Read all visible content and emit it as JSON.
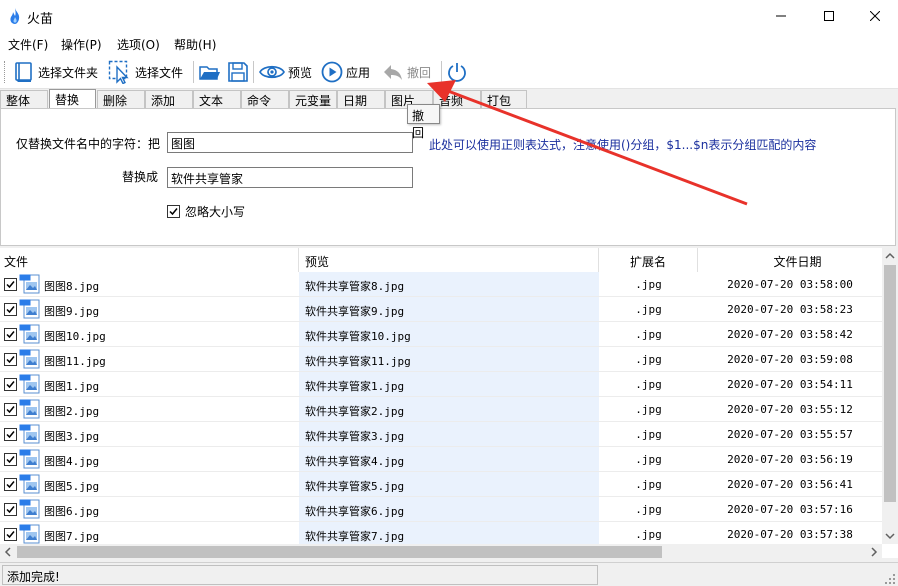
{
  "window": {
    "title": "火苗",
    "minimize_icon": "minimize-icon",
    "maximize_icon": "maximize-icon",
    "close_icon": "close-icon"
  },
  "menu": {
    "items": [
      "文件(F)",
      "操作(P)",
      "选项(O)",
      "帮助(H)"
    ]
  },
  "toolbar": {
    "select_folder": "选择文件夹",
    "select_file": "选择文件",
    "preview": "预览",
    "apply": "应用",
    "undo": "撤回"
  },
  "tabs": [
    "整体",
    "替换",
    "删除",
    "添加",
    "文本",
    "命令",
    "元变量",
    "日期",
    "图片",
    "音频",
    "打包"
  ],
  "active_tab": "替换",
  "tooltip": "撤回",
  "replace_panel": {
    "find_label": "仅替换文件名中的字符：把",
    "find_value": "图图",
    "hint": "此处可以使用正则表达式，注意使用()分组，$1...$n表示分组匹配的内容",
    "replace_label": "替换成",
    "replace_value": "软件共享管家",
    "ignore_case_label": "忽略大小写",
    "ignore_case_checked": true
  },
  "file_table": {
    "headers": [
      "文件",
      "预览",
      "扩展名",
      "文件日期"
    ],
    "rows": [
      {
        "file": "图图8.jpg",
        "preview": "软件共享管家8.jpg",
        "ext": ".jpg",
        "date": "2020-07-20 03:58:00"
      },
      {
        "file": "图图9.jpg",
        "preview": "软件共享管家9.jpg",
        "ext": ".jpg",
        "date": "2020-07-20 03:58:23"
      },
      {
        "file": "图图10.jpg",
        "preview": "软件共享管家10.jpg",
        "ext": ".jpg",
        "date": "2020-07-20 03:58:42"
      },
      {
        "file": "图图11.jpg",
        "preview": "软件共享管家11.jpg",
        "ext": ".jpg",
        "date": "2020-07-20 03:59:08"
      },
      {
        "file": "图图1.jpg",
        "preview": "软件共享管家1.jpg",
        "ext": ".jpg",
        "date": "2020-07-20 03:54:11"
      },
      {
        "file": "图图2.jpg",
        "preview": "软件共享管家2.jpg",
        "ext": ".jpg",
        "date": "2020-07-20 03:55:12"
      },
      {
        "file": "图图3.jpg",
        "preview": "软件共享管家3.jpg",
        "ext": ".jpg",
        "date": "2020-07-20 03:55:57"
      },
      {
        "file": "图图4.jpg",
        "preview": "软件共享管家4.jpg",
        "ext": ".jpg",
        "date": "2020-07-20 03:56:19"
      },
      {
        "file": "图图5.jpg",
        "preview": "软件共享管家5.jpg",
        "ext": ".jpg",
        "date": "2020-07-20 03:56:41"
      },
      {
        "file": "图图6.jpg",
        "preview": "软件共享管家6.jpg",
        "ext": ".jpg",
        "date": "2020-07-20 03:57:16"
      },
      {
        "file": "图图7.jpg",
        "preview": "软件共享管家7.jpg",
        "ext": ".jpg",
        "date": "2020-07-20 03:57:38"
      }
    ]
  },
  "status": {
    "text": "添加完成!"
  },
  "colors": {
    "hint_text": "#1a2f9e",
    "preview_column_bg": "#eaf2fd",
    "annotation_arrow": "#e8322a",
    "toolbar_icon_blue": "#1f6fc4",
    "app_icon": "#2b7de9"
  }
}
